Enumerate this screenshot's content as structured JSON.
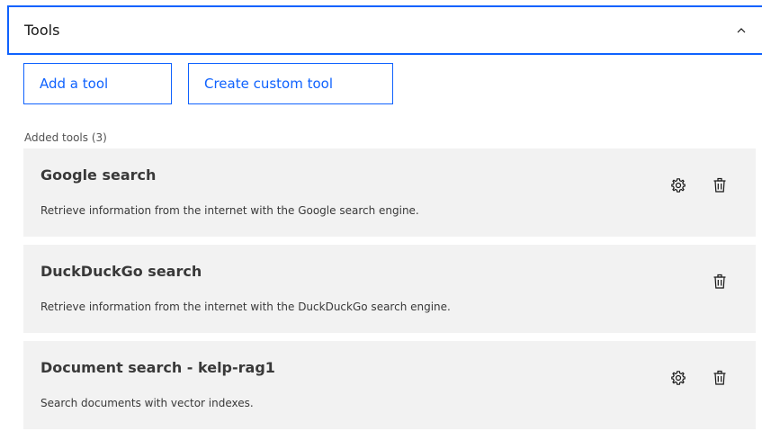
{
  "accordion": {
    "title": "Tools",
    "chevron_icon": "chevron-up-icon"
  },
  "actions": {
    "add_tool": "Add a tool",
    "create_custom": "Create custom tool"
  },
  "section_label": "Added tools (3)",
  "tools": [
    {
      "name": "Google search",
      "description": "Retrieve information from the internet with the Google search engine.",
      "has_settings": true
    },
    {
      "name": "DuckDuckGo search",
      "description": "Retrieve information from the internet with the DuckDuckGo search engine.",
      "has_settings": false
    },
    {
      "name": "Document search - kelp-rag1",
      "description": "Search documents with vector indexes.",
      "has_settings": true
    }
  ],
  "colors": {
    "accent": "#0f62fe",
    "card_bg": "#f2f2f2",
    "text": "#161616",
    "secondary_text": "#525252"
  }
}
